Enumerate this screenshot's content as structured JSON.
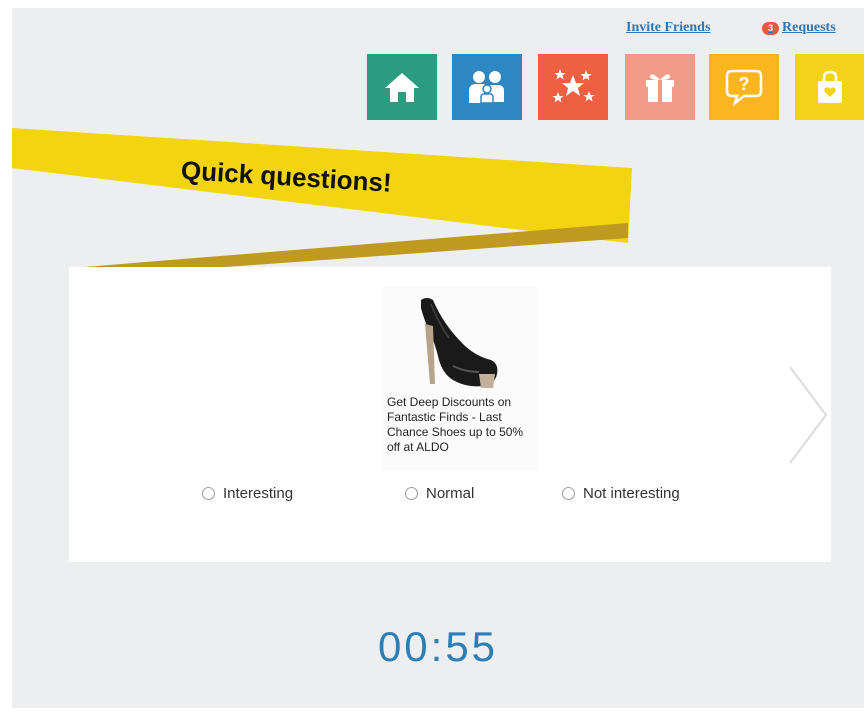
{
  "header": {
    "invite_label": "Invite Friends",
    "requests_label": "Requests",
    "requests_count": "3"
  },
  "nav": {
    "items": [
      {
        "id": "home",
        "icon": "home-icon",
        "color": "#2b9c7f"
      },
      {
        "id": "friends",
        "icon": "friends-icon",
        "color": "#2d87c3"
      },
      {
        "id": "stars",
        "icon": "stars-icon",
        "color": "#ef6042"
      },
      {
        "id": "gifts",
        "icon": "gift-icon",
        "color": "#f19a87"
      },
      {
        "id": "questions",
        "icon": "question-bubble-icon",
        "color": "#fbb51f"
      },
      {
        "id": "shop",
        "icon": "shopping-bag-icon",
        "color": "#f3d31a"
      }
    ]
  },
  "banner": {
    "title": "Quick questions!",
    "color": "#f2d50f"
  },
  "ad": {
    "image_icon": "high-heel-shoe-icon",
    "text": "Get Deep Discounts on Fantastic Finds - Last Chance Shoes up to 50% off at ALDO"
  },
  "options": {
    "interesting": "Interesting",
    "normal": "Normal",
    "not_interesting": "Not interesting"
  },
  "timer": {
    "value": "00:55"
  }
}
